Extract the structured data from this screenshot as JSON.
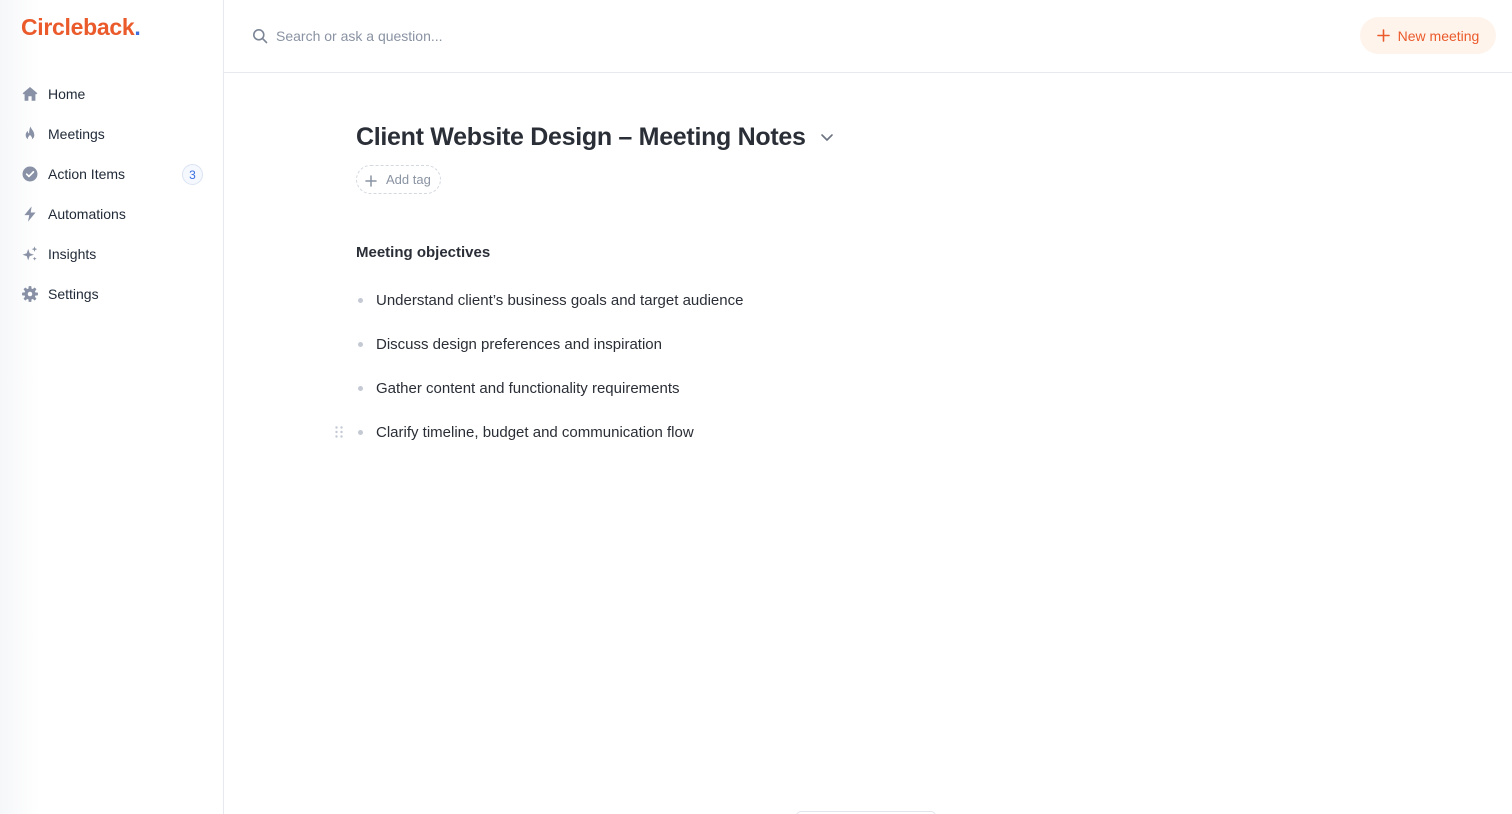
{
  "app": {
    "logo_text": "Circleback",
    "logo_dot": ".",
    "brand_color": "#ea5a2b",
    "accent_color": "#3b6fe0"
  },
  "sidebar": {
    "items": [
      {
        "label": "Home",
        "icon": "home-icon"
      },
      {
        "label": "Meetings",
        "icon": "flame-icon"
      },
      {
        "label": "Action Items",
        "icon": "check-circle-icon",
        "badge": "3"
      },
      {
        "label": "Automations",
        "icon": "lightning-icon"
      },
      {
        "label": "Insights",
        "icon": "sparkles-icon"
      },
      {
        "label": "Settings",
        "icon": "gear-icon"
      }
    ]
  },
  "header": {
    "search_placeholder": "Search or ask a question...",
    "new_meeting_label": "New meeting"
  },
  "main": {
    "title": "Client Website Design – Meeting Notes",
    "add_tag_label": "Add tag",
    "section_heading": "Meeting objectives",
    "objectives": [
      "Understand client’s business goals and target audience",
      "Discuss design preferences and inspiration",
      "Gather content and functionality requirements",
      "Clarify timeline, budget and communication flow"
    ]
  }
}
